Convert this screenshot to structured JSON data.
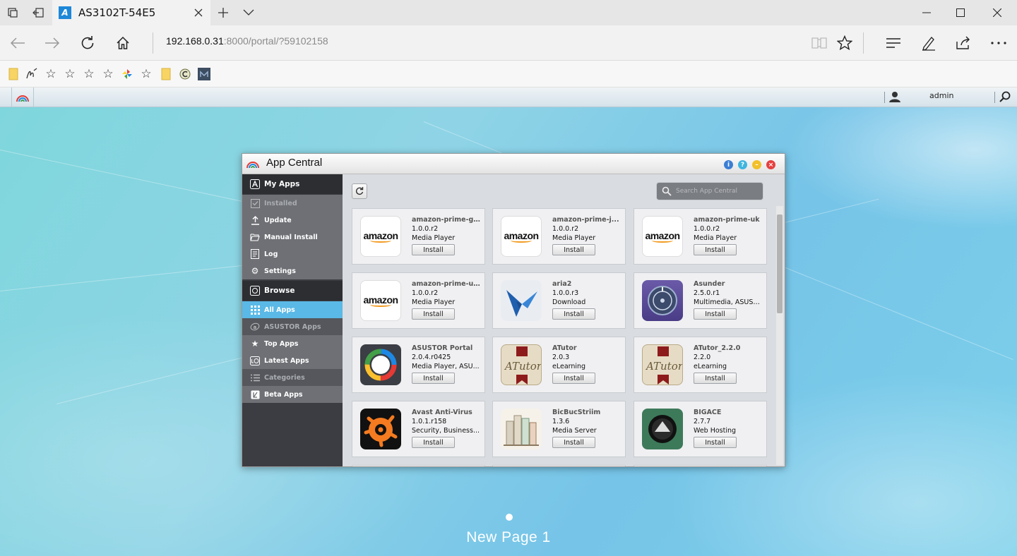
{
  "browser": {
    "tab_title": "AS3102T-54E5",
    "url_host": "192.168.0.31",
    "url_rest": ":8000/portal/?59102158"
  },
  "adm": {
    "user": "admin",
    "page_label": "New Page 1"
  },
  "window": {
    "title": "App Central"
  },
  "sidebar": {
    "my_apps": "My Apps",
    "installed": "Installed",
    "update": "Update",
    "manual_install": "Manual Install",
    "log": "Log",
    "settings": "Settings",
    "browse": "Browse",
    "all_apps": "All Apps",
    "asustor_apps": "ASUSTOR Apps",
    "top_apps": "Top Apps",
    "latest_apps": "Latest Apps",
    "categories": "Categories",
    "beta_apps": "Beta Apps"
  },
  "search": {
    "placeholder": "Search App Central"
  },
  "install_label": "Install",
  "apps": [
    {
      "name": "amazon-prime-g...",
      "version": "1.0.0.r2",
      "category": "Media Player",
      "icon": "amazon-prime-icon"
    },
    {
      "name": "amazon-prime-j...",
      "version": "1.0.0.r2",
      "category": "Media Player",
      "icon": "amazon-prime-icon"
    },
    {
      "name": "amazon-prime-uk",
      "version": "1.0.0.r2",
      "category": "Media Player",
      "icon": "amazon-prime-icon"
    },
    {
      "name": "amazon-prime-u...",
      "version": "1.0.0.r2",
      "category": "Media Player",
      "icon": "amazon-prime-icon"
    },
    {
      "name": "aria2",
      "version": "1.0.0.r3",
      "category": "Download",
      "icon": "aria2-bird-icon"
    },
    {
      "name": "Asunder",
      "version": "2.5.0.r1",
      "category": "Multimedia, ASUST...",
      "icon": "asunder-disc-icon"
    },
    {
      "name": "ASUSTOR Portal",
      "version": "2.0.4.r0425",
      "category": "Media Player, ASU...",
      "icon": "asustor-portal-ring-icon"
    },
    {
      "name": "ATutor",
      "version": "2.0.3",
      "category": "eLearning",
      "icon": "atutor-icon"
    },
    {
      "name": "ATutor_2.2.0",
      "version": "2.2.0",
      "category": "eLearning",
      "icon": "atutor-icon"
    },
    {
      "name": "Avast Anti-Virus",
      "version": "1.0.1.r158",
      "category": "Security, Business...",
      "icon": "avast-icon"
    },
    {
      "name": "BicBucStriim",
      "version": "1.3.6",
      "category": "Media Server",
      "icon": "books-icon"
    },
    {
      "name": "BIGACE",
      "version": "2.7.7",
      "category": "Web Hosting",
      "icon": "bigace-icon"
    }
  ],
  "colors": {
    "sidebar_bg": "#3b3d42",
    "sidebar_active": "#5ab9e6",
    "desktop": "#7fd0e6"
  }
}
